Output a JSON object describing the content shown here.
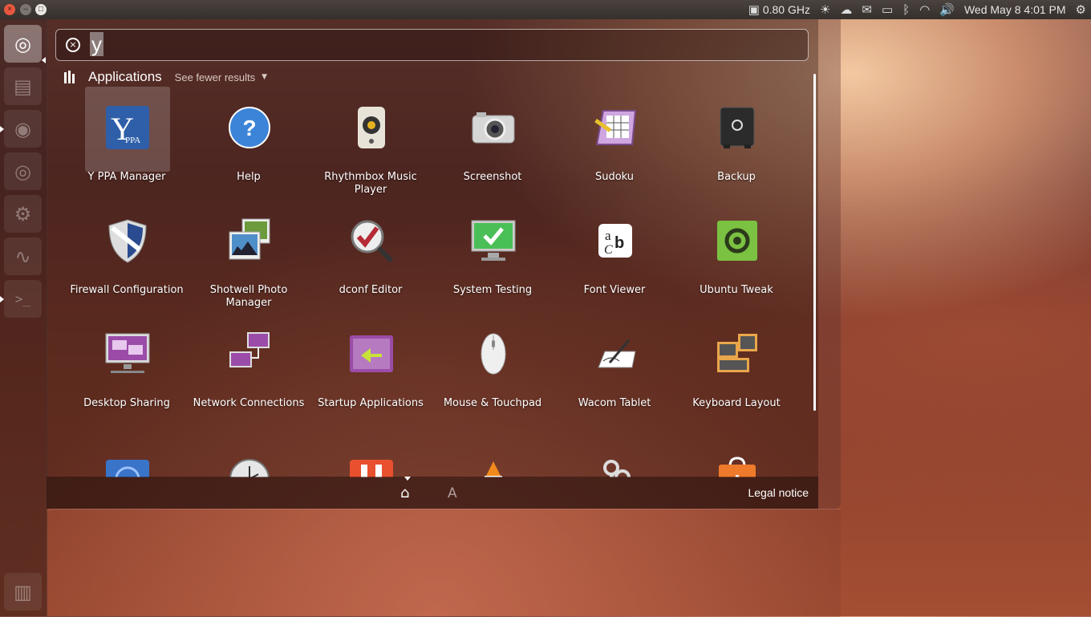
{
  "top_panel": {
    "window_buttons": {
      "close": "×",
      "minimize": "–",
      "maximize": "□"
    },
    "indicators": [
      {
        "name": "cpu-freq",
        "icon": "▣",
        "text": "0.80 GHz"
      },
      {
        "name": "weather",
        "icon": "☀",
        "text": ""
      },
      {
        "name": "cloud",
        "icon": "☁",
        "text": ""
      },
      {
        "name": "mail",
        "icon": "✉",
        "text": ""
      },
      {
        "name": "battery",
        "icon": "▭",
        "text": ""
      },
      {
        "name": "bluetooth",
        "icon": "ᛒ",
        "text": ""
      },
      {
        "name": "wifi",
        "icon": "◠",
        "text": ""
      },
      {
        "name": "volume",
        "icon": "🔊",
        "text": ""
      },
      {
        "name": "clock",
        "icon": "",
        "text": "Wed May 8   4:01 PM"
      },
      {
        "name": "settings",
        "icon": "⚙",
        "text": ""
      }
    ]
  },
  "launcher": {
    "items": [
      {
        "name": "ubuntu-dash",
        "icon": "◎"
      },
      {
        "name": "files",
        "icon": "▤"
      },
      {
        "name": "firefox",
        "icon": "◉"
      },
      {
        "name": "disc",
        "icon": "◎"
      },
      {
        "name": "system-settings",
        "icon": "⚙"
      },
      {
        "name": "system-monitor",
        "icon": "∿"
      },
      {
        "name": "terminal",
        "icon": ">_"
      },
      {
        "name": "trash",
        "icon": "▥"
      }
    ]
  },
  "search": {
    "clear_icon": "×",
    "query": "y"
  },
  "section": {
    "title": "Applications",
    "toggle": "See fewer results",
    "caret": "▼"
  },
  "apps": [
    {
      "label": "Y PPA Manager",
      "icon": "yppa",
      "color": "#2f5fa8"
    },
    {
      "label": "Help",
      "icon": "help",
      "color": "#3c84d8"
    },
    {
      "label": "Rhythmbox Music Player",
      "icon": "speaker",
      "color": "#e8e3d8"
    },
    {
      "label": "Screenshot",
      "icon": "camera",
      "color": "#d6d6d6"
    },
    {
      "label": "Sudoku",
      "icon": "sudoku",
      "color": "#cfa6e0"
    },
    {
      "label": "Backup",
      "icon": "safe",
      "color": "#2b2b2b"
    },
    {
      "label": "Firewall Configuration",
      "icon": "shield",
      "color": "#2a4b8f"
    },
    {
      "label": "Shotwell Photo Manager",
      "icon": "photos",
      "color": "#4f8fc9"
    },
    {
      "label": "dconf Editor",
      "icon": "dconf",
      "color": "#b52b36"
    },
    {
      "label": "System Testing",
      "icon": "monitor-check",
      "color": "#4bbf57"
    },
    {
      "label": "Font Viewer",
      "icon": "font",
      "color": "#ffffff"
    },
    {
      "label": "Ubuntu Tweak",
      "icon": "tweak",
      "color": "#7bc142"
    },
    {
      "label": "Desktop Sharing",
      "icon": "desktop-share",
      "color": "#9b4ca8"
    },
    {
      "label": "Network Connections",
      "icon": "network",
      "color": "#9b4ca8"
    },
    {
      "label": "Startup Applications",
      "icon": "startup",
      "color": "#9b4ca8"
    },
    {
      "label": "Mouse & Touchpad",
      "icon": "mouse",
      "color": "#efefef"
    },
    {
      "label": "Wacom Tablet",
      "icon": "tablet",
      "color": "#ffffff"
    },
    {
      "label": "Keyboard Layout",
      "icon": "keyboard",
      "color": "#e9a64a"
    },
    {
      "label": "",
      "icon": "partial-globe",
      "color": "#3a74c8"
    },
    {
      "label": "",
      "icon": "partial-clock",
      "color": "#e6e6e6"
    },
    {
      "label": "",
      "icon": "partial-orange",
      "color": "#e8502e"
    },
    {
      "label": "",
      "icon": "partial-vlc",
      "color": "#f08a1c"
    },
    {
      "label": "",
      "icon": "partial-keys",
      "color": "#dcdcdc"
    },
    {
      "label": "",
      "icon": "partial-bag",
      "color": "#ef7a2b"
    }
  ],
  "lens_bar": {
    "home_icon": "⌂",
    "apps_icon": "A",
    "legal": "Legal notice"
  }
}
